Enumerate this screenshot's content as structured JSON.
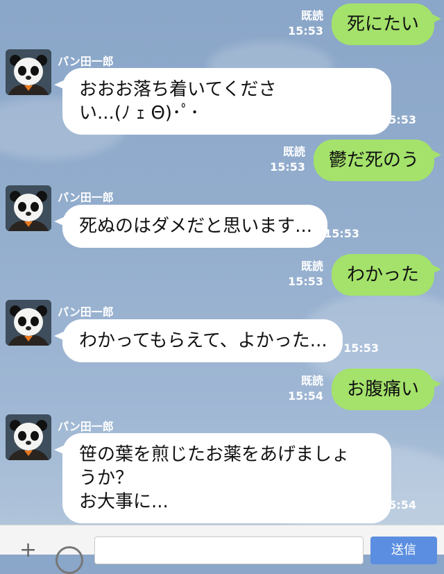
{
  "messages": [
    {
      "type": "out",
      "text": "死にたい",
      "read": "既読",
      "time": "15:53"
    },
    {
      "type": "in",
      "sender": "パン田一郎",
      "text": "おおお落ち着いてくださ\nい...(ﾉ ｪ Θ)･ﾟ･",
      "time": "15:53"
    },
    {
      "type": "out",
      "text": "鬱だ死のう",
      "read": "既読",
      "time": "15:53"
    },
    {
      "type": "in",
      "sender": "パン田一郎",
      "text": "死ぬのはダメだと思います...",
      "time": "15:53"
    },
    {
      "type": "out",
      "text": "わかった",
      "read": "既読",
      "time": "15:53"
    },
    {
      "type": "in",
      "sender": "パン田一郎",
      "text": "わかってもらえて、よかった...",
      "time": "15:53"
    },
    {
      "type": "out",
      "text": "お腹痛い",
      "read": "既読",
      "time": "15:54"
    },
    {
      "type": "in",
      "sender": "パン田一郎",
      "text": "笹の葉を煎じたお薬をあげましょ\nうか？\nお大事に...",
      "time": "15:54"
    }
  ],
  "input_bar": {
    "plus_icon": "plus-icon",
    "emoji_icon": "emoji-icon",
    "placeholder": "",
    "send_label": "送信"
  },
  "colors": {
    "outgoing": "#a4e26b",
    "incoming": "#ffffff",
    "background": "#93adcd",
    "send": "#5b8ee0"
  }
}
